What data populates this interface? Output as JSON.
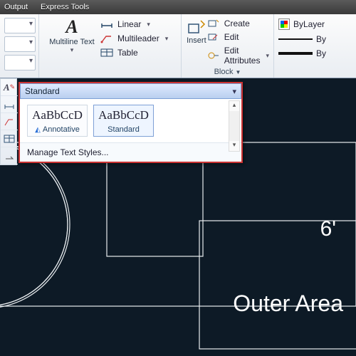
{
  "menubar": {
    "items": [
      "Output",
      "Express Tools"
    ]
  },
  "ribbon": {
    "annotation": {
      "multiline": "Multiline Text",
      "rows": {
        "linear": "Linear",
        "multileader": "Multileader",
        "table": "Table"
      }
    },
    "block": {
      "insert": "Insert",
      "rows": {
        "create": "Create",
        "edit": "Edit",
        "edit_attrs": "Edit Attributes"
      },
      "panel_label": "Block"
    },
    "props": {
      "bylayer": "ByLayer",
      "byline1": "By",
      "byline2": "By"
    }
  },
  "dropdown": {
    "current": "Standard",
    "styles": {
      "annotative": "Annotative",
      "standard": "Standard",
      "sample": "AaBbCcD"
    },
    "manage": "Manage Text Styles..."
  },
  "drawing": {
    "dim_label": "6'",
    "area_label": "Outer Area"
  }
}
